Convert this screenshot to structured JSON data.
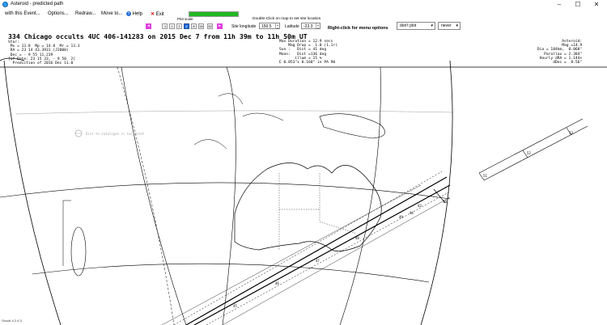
{
  "window": {
    "title": "Asteroid - predicted path",
    "controls": [
      "–",
      "☐",
      "✕"
    ]
  },
  "menu": {
    "with_event": "with this Event...",
    "options": "Options...",
    "redraw": "Redraw...",
    "move_to": "Move to...",
    "help": "Help",
    "exit": "Exit"
  },
  "progress": {
    "fraction": 1.0
  },
  "plot_scale": {
    "label": "Plot scale",
    "buttons": [
      ".1",
      "1",
      "2",
      "4",
      "8",
      "16",
      "32"
    ],
    "selected": "4"
  },
  "site": {
    "hint": "Double-Click on map to set site location",
    "longitude_label": "Site longitude",
    "longitude_value": "150.5",
    "latitude_label": "Latitude",
    "latitude_value": "-23.3"
  },
  "right_click_hint": "Right-click for menu options",
  "plot_select": "don't plot",
  "never_select": "never",
  "event": {
    "headline": "334 Chicago occults 4UC 406-141283 on 2015 Dec  7 from 11h 39m to 11h 50m UT",
    "star_block": "Star:\n Mv = 13.8  Mp = 14.8  Mr = 13.3\n RA = 23 14 43.3931 (J2000)\n Dec = - 9 55 11.239\n[of Date: 23 15 33, - 9 50  2]\n  Prediction of 2016 Dec 11.0",
    "max_block": "Max Duration = 12.9 secs\n    Mag Drop =  1.0 (1.1r)\nSun :   Dist = 41 deg\nMoon:   Dist =136 deg\n       illum = 15 %\nE 0.053\"x 0.160\" in PA 90",
    "asteroid_block": "Asteroid:\n     Mag =14.9\n     Dia = 184km,  0.068\"\nParallax = 2.384\"\nHourly dRA = 1.144s\n   dDec =  8.56\""
  },
  "map_labels": {
    "catalogue_note": "Dist to catalogue is too great",
    "path_ticks": [
      "49",
      "48",
      "47",
      "46",
      "45",
      "50",
      "44",
      "43"
    ],
    "inset_ticks": [
      "51",
      "52",
      "53"
    ]
  },
  "footer": "Occult 4.2.4.3"
}
